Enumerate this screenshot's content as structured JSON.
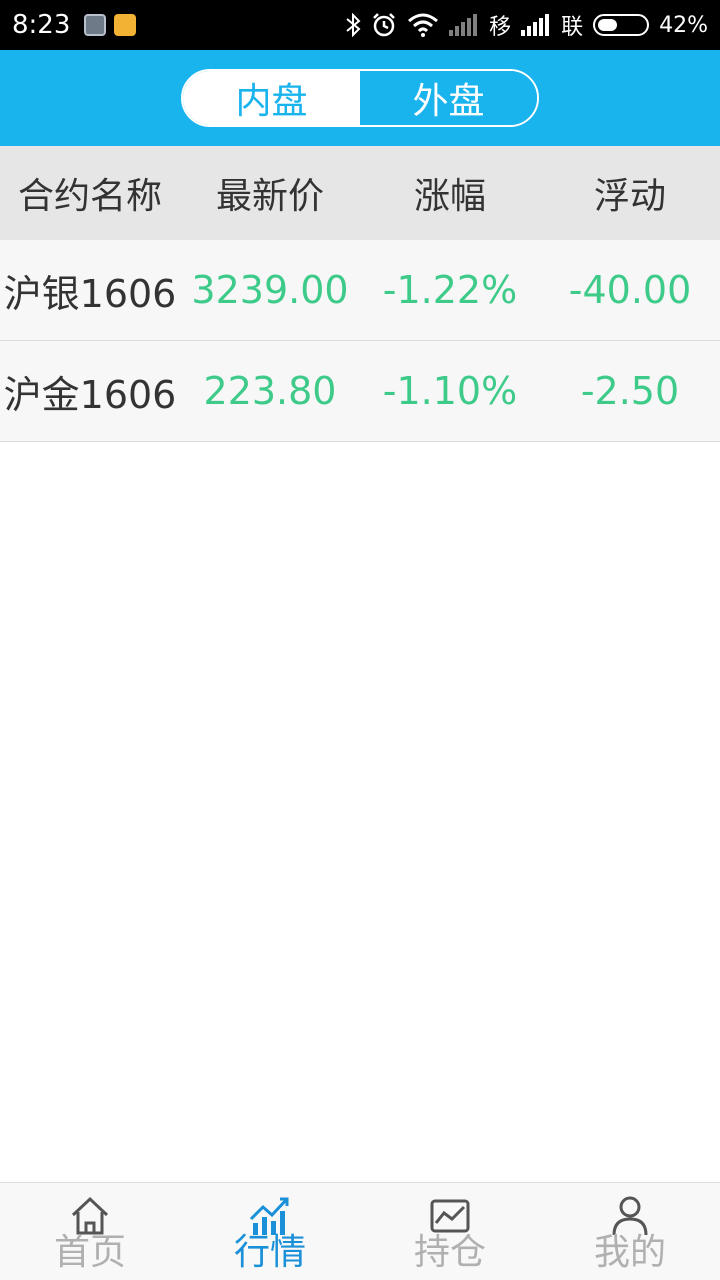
{
  "status_bar": {
    "time": "8:23",
    "carrier1": "移",
    "carrier2": "联",
    "battery": "42%",
    "battery_level": 0.42
  },
  "header": {
    "tabs": [
      {
        "label": "内盘",
        "active": true
      },
      {
        "label": "外盘",
        "active": false
      }
    ]
  },
  "table": {
    "columns": [
      "合约名称",
      "最新价",
      "涨幅",
      "浮动"
    ],
    "rows": [
      {
        "name": "沪银1606",
        "price": "3239.00",
        "change": "-1.22%",
        "float": "-40.00"
      },
      {
        "name": "沪金1606",
        "price": "223.80",
        "change": "-1.10%",
        "float": "-2.50"
      }
    ]
  },
  "bottom_nav": {
    "items": [
      {
        "label": "首页",
        "icon": "home-icon",
        "active": false
      },
      {
        "label": "行情",
        "icon": "chart-icon",
        "active": true
      },
      {
        "label": "持仓",
        "icon": "portfolio-icon",
        "active": false
      },
      {
        "label": "我的",
        "icon": "user-icon",
        "active": false
      }
    ]
  },
  "colors": {
    "accent": "#19b3ee",
    "price_down": "#3ecb8a",
    "nav_active": "#1a90d8",
    "nav_inactive": "#b0b0b0"
  }
}
